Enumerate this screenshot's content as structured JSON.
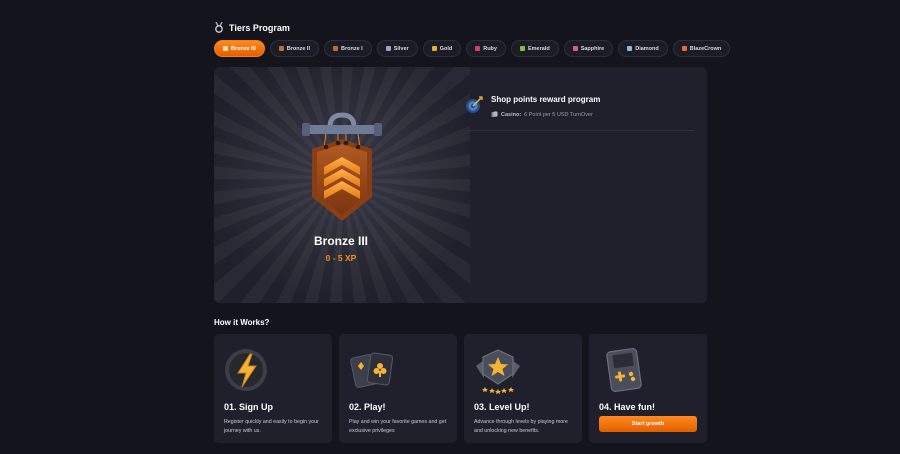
{
  "header": {
    "title": "Tiers Program",
    "icon": "medal-icon"
  },
  "tiers": [
    {
      "label": "Bronze III",
      "active": true,
      "color": "#ff7a12"
    },
    {
      "label": "Bronze II",
      "active": false,
      "color": "#c46a2e"
    },
    {
      "label": "Bronze I",
      "active": false,
      "color": "#c46a2e"
    },
    {
      "label": "Silver",
      "active": false,
      "color": "#9aa6c4"
    },
    {
      "label": "Gold",
      "active": false,
      "color": "#e1b03a"
    },
    {
      "label": "Ruby",
      "active": false,
      "color": "#d2405b"
    },
    {
      "label": "Emerald",
      "active": false,
      "color": "#7fc23a"
    },
    {
      "label": "Sapphire",
      "active": false,
      "color": "#d95a9a"
    },
    {
      "label": "Diamond",
      "active": false,
      "color": "#8fb4e8"
    },
    {
      "label": "BlazeCrown",
      "active": false,
      "color": "#e86a3a"
    }
  ],
  "current_tier": {
    "name": "Bronze III",
    "xp_range": "0 - 5 XP"
  },
  "reward": {
    "title": "Shop points reward program",
    "line_label": "Casino:",
    "line_value": "6 Point per 5 USD TurnOver"
  },
  "how": {
    "title": "How it Works?",
    "steps": [
      {
        "title": "01. Sign Up",
        "desc": "Register quickly and easily to begin your journey with us.",
        "icon": "lightning-shield-icon"
      },
      {
        "title": "02. Play!",
        "desc": "Play and win your favorite games and get exclusive privileges",
        "icon": "playing-cards-icon"
      },
      {
        "title": "03. Level Up!",
        "desc": "Advance through levels by playing more and unlocking new benefits.",
        "icon": "star-badge-icon"
      },
      {
        "title": "04. Have fun!",
        "button": "Start growth",
        "icon": "game-console-icon"
      }
    ]
  },
  "colors": {
    "accent": "#ff7a12",
    "bg": "#14151c",
    "card": "#1f202b"
  }
}
